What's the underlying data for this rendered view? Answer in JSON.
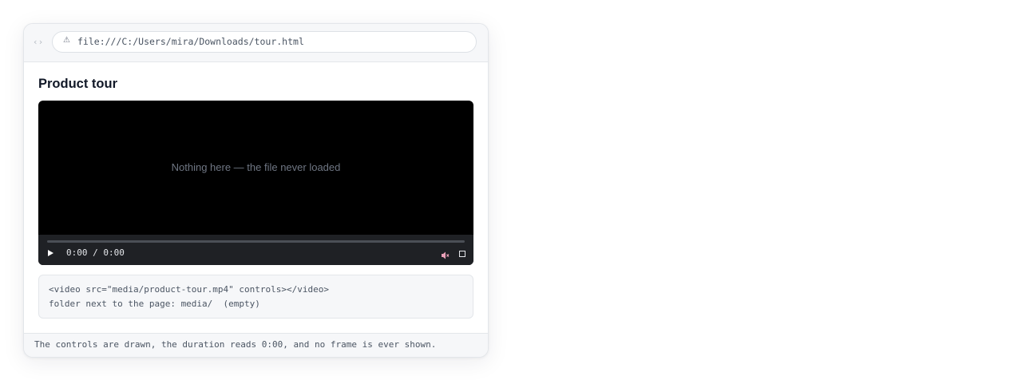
{
  "browser": {
    "nav_arrows": "‹›",
    "warning_icon": "warning-icon",
    "url": "file:///C:/Users/mira/Downloads/tour.html"
  },
  "page": {
    "title": "Product tour"
  },
  "video": {
    "empty_message": "Nothing here — the file never loaded",
    "time": "0:00 / 0:00",
    "progress": 0,
    "play_icon": "play-icon",
    "mute_icon": "muted-speaker-icon",
    "fullscreen_icon": "fullscreen-icon"
  },
  "code": {
    "line1": "<video src=\"media/product-tour.mp4\" controls></video>",
    "line2": "folder next to the page: media/  (empty)"
  },
  "status": {
    "text": "The controls are drawn, the duration reads 0:00, and no frame is ever shown."
  },
  "colors": {
    "player_bg": "#000000",
    "controls_bg": "#1f2125",
    "mute_accent": "#e9a0b8"
  }
}
